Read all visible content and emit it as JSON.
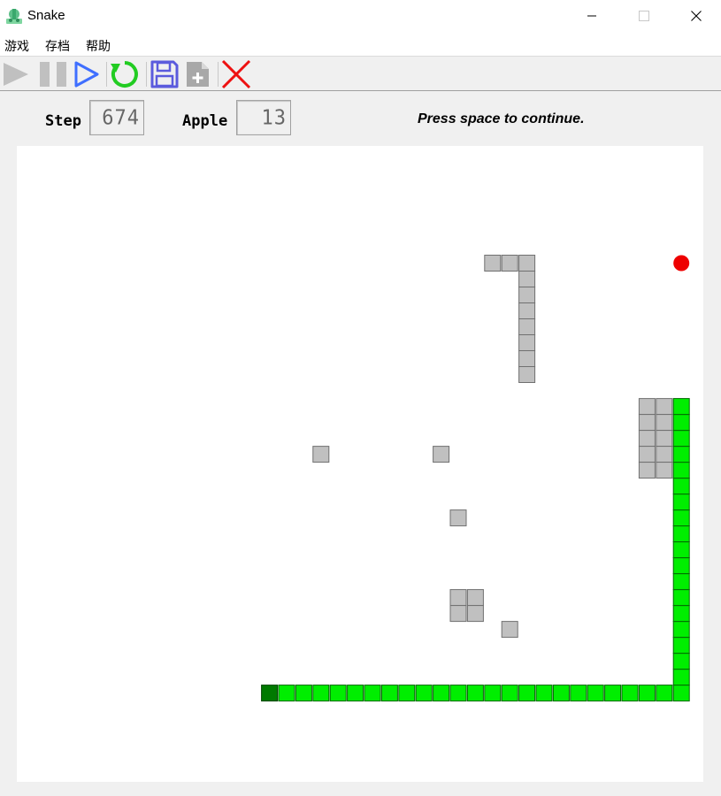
{
  "window": {
    "title": "Snake",
    "icon": "snake-app-icon"
  },
  "window_controls": {
    "minimize": "minimize-icon",
    "maximize": "maximize-icon",
    "close": "close-icon"
  },
  "menu": {
    "items": [
      "游戏",
      "存档",
      "帮助"
    ]
  },
  "toolbar": {
    "buttons": [
      {
        "name": "play-button",
        "icon": "play-icon",
        "enabled": false,
        "color": "#c0c0c0"
      },
      {
        "name": "pause-button",
        "icon": "pause-icon",
        "enabled": false,
        "color": "#c0c0c0"
      },
      {
        "name": "step-button",
        "icon": "step-play-icon",
        "enabled": true,
        "color": "#3f6fff"
      },
      {
        "name": "restart-button",
        "icon": "restart-icon",
        "enabled": true,
        "color": "#22cc22"
      },
      {
        "name": "save-button",
        "icon": "save-icon",
        "enabled": true,
        "color": "#5b5bdd"
      },
      {
        "name": "load-button",
        "icon": "load-file-icon",
        "enabled": false,
        "color": "#a8a8a8"
      },
      {
        "name": "quit-button",
        "icon": "close-x-icon",
        "enabled": true,
        "color": "#ee1111"
      }
    ]
  },
  "stats": {
    "step_label": "Step",
    "step_value": "674",
    "apple_label": "Apple",
    "apple_value": "13",
    "status": "Press space to continue."
  },
  "colors": {
    "snake_body": "#00ee00",
    "snake_head": "#007a00",
    "obstacle": "#c0c0c0",
    "apple": "#ee0000",
    "board": "#ffffff"
  },
  "board": {
    "obstacles": [
      [
        28,
        7
      ],
      [
        29,
        7
      ],
      [
        30,
        7
      ],
      [
        30,
        8
      ],
      [
        30,
        9
      ],
      [
        30,
        10
      ],
      [
        30,
        11
      ],
      [
        30,
        12
      ],
      [
        30,
        13
      ],
      [
        30,
        14
      ],
      [
        37,
        16
      ],
      [
        38,
        16
      ],
      [
        37,
        17
      ],
      [
        38,
        17
      ],
      [
        37,
        18
      ],
      [
        38,
        18
      ],
      [
        37,
        19
      ],
      [
        38,
        19
      ],
      [
        37,
        20
      ],
      [
        38,
        20
      ],
      [
        18,
        19
      ],
      [
        25,
        19
      ],
      [
        26,
        23
      ],
      [
        26,
        28
      ],
      [
        27,
        28
      ],
      [
        26,
        29
      ],
      [
        27,
        29
      ],
      [
        29,
        30
      ]
    ],
    "apple": [
      39,
      7
    ],
    "snake_head": [
      15,
      34
    ],
    "snake_body": [
      [
        16,
        34
      ],
      [
        17,
        34
      ],
      [
        18,
        34
      ],
      [
        19,
        34
      ],
      [
        20,
        34
      ],
      [
        21,
        34
      ],
      [
        22,
        34
      ],
      [
        23,
        34
      ],
      [
        24,
        34
      ],
      [
        25,
        34
      ],
      [
        26,
        34
      ],
      [
        27,
        34
      ],
      [
        28,
        34
      ],
      [
        29,
        34
      ],
      [
        30,
        34
      ],
      [
        31,
        34
      ],
      [
        32,
        34
      ],
      [
        33,
        34
      ],
      [
        34,
        34
      ],
      [
        35,
        34
      ],
      [
        36,
        34
      ],
      [
        37,
        34
      ],
      [
        38,
        34
      ],
      [
        39,
        34
      ],
      [
        39,
        33
      ],
      [
        39,
        32
      ],
      [
        39,
        31
      ],
      [
        39,
        30
      ],
      [
        39,
        29
      ],
      [
        39,
        28
      ],
      [
        39,
        27
      ],
      [
        39,
        26
      ],
      [
        39,
        25
      ],
      [
        39,
        24
      ],
      [
        39,
        23
      ],
      [
        39,
        22
      ],
      [
        39,
        21
      ],
      [
        39,
        20
      ],
      [
        39,
        19
      ],
      [
        39,
        18
      ],
      [
        39,
        17
      ],
      [
        39,
        16
      ]
    ]
  }
}
